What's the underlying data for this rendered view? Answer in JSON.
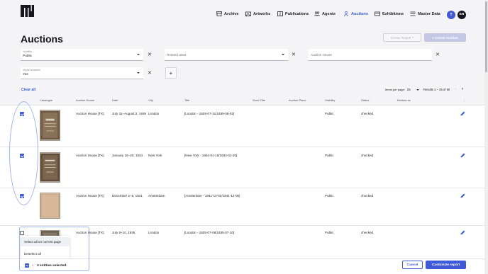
{
  "nav": {
    "items": [
      {
        "label": "Archive",
        "icon": "archive-icon"
      },
      {
        "label": "Artworks",
        "icon": "artwork-icon"
      },
      {
        "label": "Publications",
        "icon": "publication-icon"
      },
      {
        "label": "Agents",
        "icon": "agents-icon"
      },
      {
        "label": "Auctions",
        "icon": "auction-icon",
        "active": true
      },
      {
        "label": "Exhibitions",
        "icon": "exhibition-icon"
      },
      {
        "label": "Master Data",
        "icon": "list-icon"
      }
    ],
    "user_initial": "T",
    "language": "EN",
    "accent_color": "#3a5bd9"
  },
  "page": {
    "title": "Auctions",
    "create_report_label": "Create Report",
    "create_auction_label": "+  Create Auction"
  },
  "filters": {
    "visibility_label": "Visibility",
    "visibility_value": "Public",
    "related_artist_placeholder": "Related artist",
    "auction_house_placeholder": "Auction House",
    "media_label": "Media available",
    "media_value": "Yes",
    "clear_symbol": "✕",
    "add_symbol": "+"
  },
  "toolbar": {
    "clear_all": "Clear all",
    "items_per_page_label": "Items per page:",
    "items_per_page_value": "25",
    "results": "Results 1 – 25 of 60",
    "prev": "‹",
    "next": "›"
  },
  "table": {
    "columns": [
      "Catalogue",
      "Auction House",
      "Date",
      "City",
      "Title",
      "Short Title",
      "Auction Place",
      "Visibility",
      "Status",
      "Marked as"
    ],
    "column_menu": "⋮",
    "rows": [
      {
        "checked": true,
        "auction_house": "Auction House [TK]",
        "date": "July 31–August 2, 1939",
        "city": "London",
        "title": "[London - 1939-07-31/1939-08-02]",
        "visibility": "Public",
        "status": "checked"
      },
      {
        "checked": true,
        "auction_house": "Auction House [TK]",
        "date": "January 16–20, 1934",
        "city": "New York",
        "title": "[New York - 1934-01-16/1934-01-20]",
        "visibility": "Public",
        "status": "checked"
      },
      {
        "checked": true,
        "auction_house": "Auction House [TK]",
        "date": "December 2–5, 1941",
        "city": "Amsterdam",
        "title": "[Amsterdam - 1941-12-02/1941-12-05]",
        "visibility": "Public",
        "status": "checked"
      },
      {
        "checked": false,
        "auction_house": "Auction House [TK]",
        "date": "July 8–10, 1935",
        "city": "London",
        "title": "[London - 1935-07-08/1935-07-10]",
        "visibility": "Public",
        "status": "checked"
      }
    ]
  },
  "selection_menu": {
    "select_all_page": "Select all on current page",
    "deselect_all": "Deselect all"
  },
  "footer": {
    "caret": "˄",
    "selected_text": "3 entities selected.",
    "cancel_label": "Cancel",
    "customize_label": "Customize report"
  }
}
